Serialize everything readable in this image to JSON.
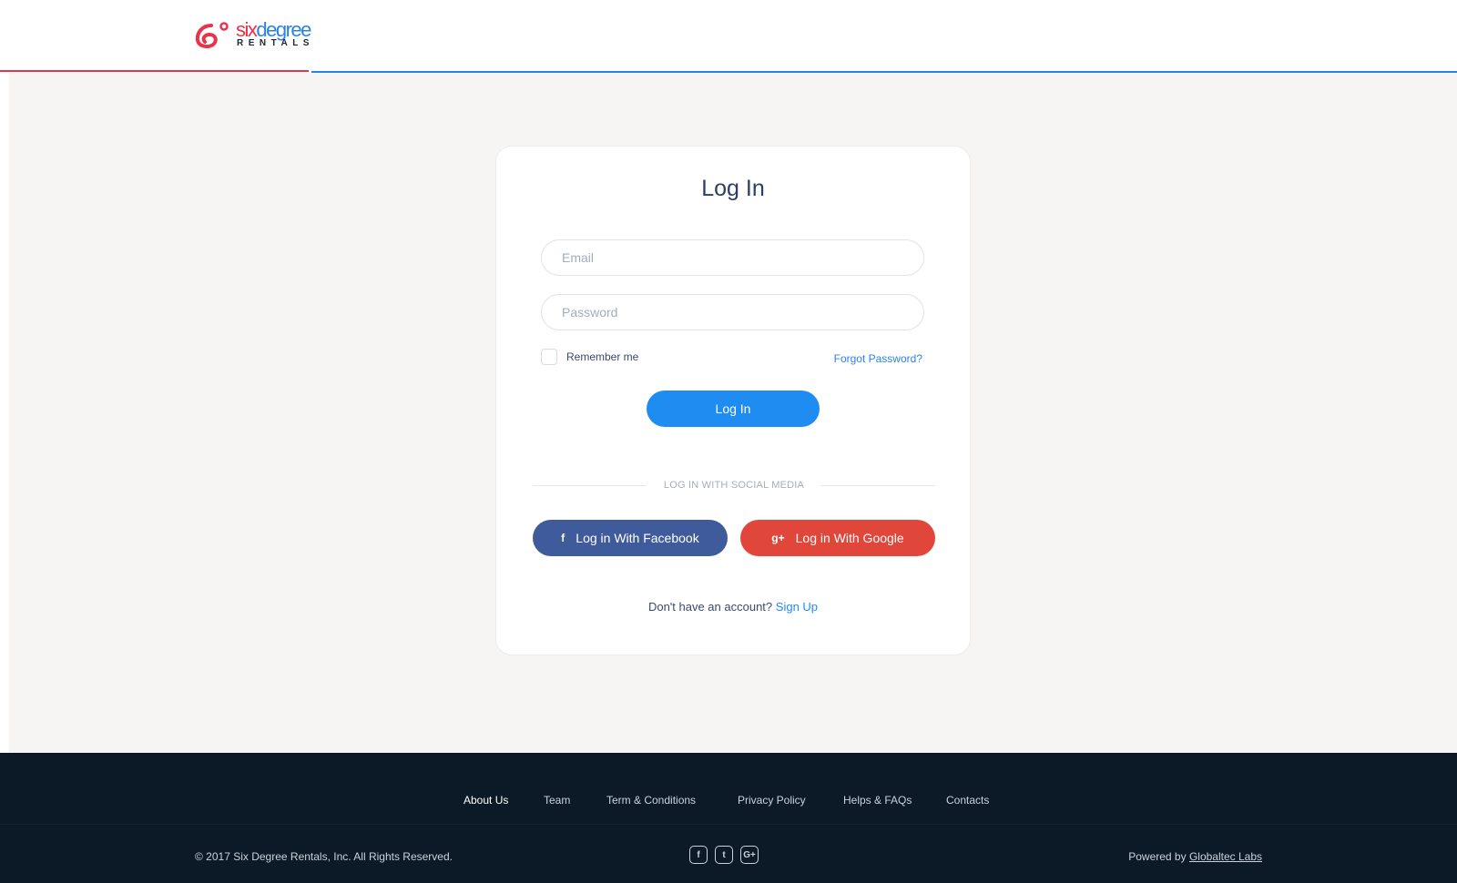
{
  "brand": {
    "name_part1": "six",
    "name_part2": "degree",
    "tagline": "RENTALS",
    "colors": {
      "red": "#e8334a",
      "blue": "#2b82e4"
    }
  },
  "login": {
    "title": "Log In",
    "email_placeholder": "Email",
    "password_placeholder": "Password",
    "remember_label": "Remember me",
    "forgot_label": "Forgot Password?",
    "submit_label": "Log In",
    "social_divider": "LOG IN WITH SOCIAL MEDIA",
    "facebook_icon": "f",
    "facebook_label": "Log in With Facebook",
    "google_icon": "g+",
    "google_label": "Log in With Google",
    "signup_prompt": "Don't have an account?",
    "signup_link": "Sign Up"
  },
  "footer": {
    "nav": [
      {
        "label": "About Us",
        "active": true
      },
      {
        "label": "Team"
      },
      {
        "label": "Term & Conditions"
      },
      {
        "label": "Privacy Policy"
      },
      {
        "label": "Helps & FAQs"
      },
      {
        "label": "Contacts"
      }
    ],
    "copyright": "© 2017  Six Degree Rentals, Inc. All Rights Reserved.",
    "socials": [
      {
        "icon": "facebook-icon",
        "glyph": "f"
      },
      {
        "icon": "twitter-icon",
        "glyph": "t"
      },
      {
        "icon": "google-plus-icon",
        "glyph": "G+"
      }
    ],
    "powered_prefix": "Powered by",
    "powered_link": "Globaltec Labs"
  }
}
